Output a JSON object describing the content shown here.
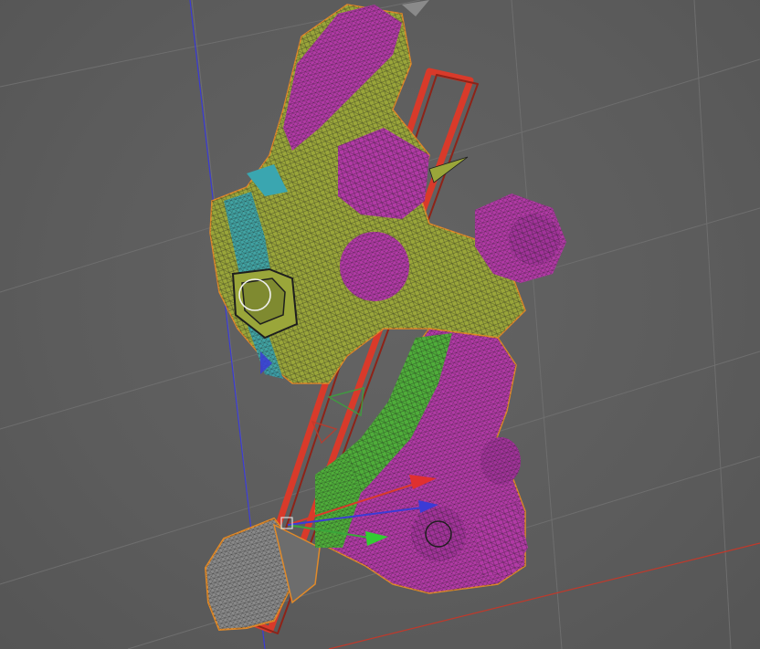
{
  "viewport": {
    "background_color": "#5c5c5c",
    "grid_color": "#6e6e6e",
    "axis_colors": {
      "x": "#c0392b",
      "y": "#3aa63a",
      "z": "#3b3bd6"
    }
  },
  "model": {
    "wireframe": true,
    "material_colors": {
      "olive": "#9aa63a",
      "magenta": "#b23aa6",
      "green": "#4fae3a",
      "cyan": "#3aa6b0",
      "gray": "#8a8a8a",
      "selection_outline": "#e08a2a",
      "bounding_box": "#d93a2a"
    }
  },
  "gizmo": {
    "type": "move",
    "icons": [
      "move-x-arrow-icon",
      "move-y-arrow-icon",
      "move-z-arrow-icon"
    ]
  },
  "pivot_marker": {
    "icon": "pivot-circle-icon"
  }
}
